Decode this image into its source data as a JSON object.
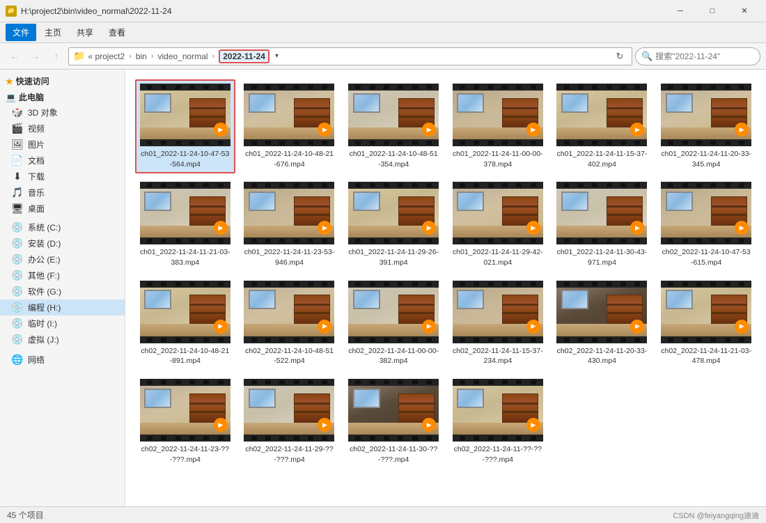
{
  "titlebar": {
    "path": "H:\\project2\\bin\\video_normal\\2022-11-24",
    "controls": {
      "minimize": "─",
      "maximize": "□",
      "close": "✕"
    }
  },
  "menubar": {
    "items": [
      "文件",
      "主页",
      "共享",
      "查看"
    ]
  },
  "addressbar": {
    "crumbs": [
      "project2",
      "bin",
      "video_normal",
      "2022-11-24"
    ],
    "search_placeholder": "搜索\"2022-11-24\""
  },
  "sidebar": {
    "quick_access": {
      "label": "快速访问",
      "icon": "★"
    },
    "this_pc": {
      "label": "此电脑",
      "icon": "💻",
      "children": [
        {
          "label": "3D 对象",
          "icon": "🎲"
        },
        {
          "label": "视频",
          "icon": "🎬"
        },
        {
          "label": "图片",
          "icon": "🖼"
        },
        {
          "label": "文档",
          "icon": "📄"
        },
        {
          "label": "下载",
          "icon": "⬇"
        },
        {
          "label": "音乐",
          "icon": "🎵"
        },
        {
          "label": "桌面",
          "icon": "🖥"
        }
      ]
    },
    "drives": [
      {
        "label": "系统 (C:)",
        "icon": "💿"
      },
      {
        "label": "安装 (D:)",
        "icon": "💿"
      },
      {
        "label": "办公 (E:)",
        "icon": "💿"
      },
      {
        "label": "其他 (F:)",
        "icon": "💿"
      },
      {
        "label": "软件 (G:)",
        "icon": "💿"
      },
      {
        "label": "编程 (H:)",
        "icon": "💿",
        "active": true
      },
      {
        "label": "临时 (I:)",
        "icon": "💿"
      },
      {
        "label": "虚拟 (J:)",
        "icon": "💿"
      }
    ],
    "network": {
      "label": "网络",
      "icon": "🌐"
    }
  },
  "files": [
    {
      "name": "ch01_2022-11-24-10-47-53-564.mp4",
      "selected": true,
      "variant": 1
    },
    {
      "name": "ch01_2022-11-24-10-48-21-676.mp4",
      "selected": false,
      "variant": 2
    },
    {
      "name": "ch01_2022-11-24-10-48-51-354.mp4",
      "selected": false,
      "variant": 3
    },
    {
      "name": "ch01_2022-11-24-11-00-00-378.mp4",
      "selected": false,
      "variant": 4
    },
    {
      "name": "ch01_2022-11-24-11-15-37-402.mp4",
      "selected": false,
      "variant": 1
    },
    {
      "name": "ch01_2022-11-24-11-20-33-345.mp4",
      "selected": false,
      "variant": 2
    },
    {
      "name": "ch01_2022-11-24-11-21-03-383.mp4",
      "selected": false,
      "variant": 3
    },
    {
      "name": "ch01_2022-11-24-11-23-53-946.mp4",
      "selected": false,
      "variant": 4
    },
    {
      "name": "ch01_2022-11-24-11-29-26-391.mp4",
      "selected": false,
      "variant": 1
    },
    {
      "name": "ch01_2022-11-24-11-29-42-021.mp4",
      "selected": false,
      "variant": 2
    },
    {
      "name": "ch01_2022-11-24-11-30-43-971.mp4",
      "selected": false,
      "variant": 3
    },
    {
      "name": "ch02_2022-11-24-10-47-53-615.mp4",
      "selected": false,
      "variant": 4
    },
    {
      "name": "ch02_2022-11-24-10-48-21-891.mp4",
      "selected": false,
      "variant": 1
    },
    {
      "name": "ch02_2022-11-24-10-48-51-522.mp4",
      "selected": false,
      "variant": 2
    },
    {
      "name": "ch02_2022-11-24-11-00-00-382.mp4",
      "selected": false,
      "variant": 3
    },
    {
      "name": "ch02_2022-11-24-11-15-37-234.mp4",
      "selected": false,
      "variant": 4
    },
    {
      "name": "ch02_2022-11-24-11-20-33-430.mp4",
      "selected": false,
      "variant": 5
    },
    {
      "name": "ch02_2022-11-24-11-21-03-478.mp4",
      "selected": false,
      "variant": 1
    },
    {
      "name": "ch02_2022-11-24-11-23-??-???.mp4",
      "selected": false,
      "variant": 2
    },
    {
      "name": "ch02_2022-11-24-11-29-??-???.mp4",
      "selected": false,
      "variant": 3
    },
    {
      "name": "ch02_2022-11-24-11-30-??-???.mp4",
      "selected": false,
      "variant": 5
    },
    {
      "name": "ch02_2022-11-24-11-??-??-???.mp4",
      "selected": false,
      "variant": 1
    }
  ],
  "statusbar": {
    "count": "45 个项目",
    "watermark": "CSDN @feiyangqing迪迪"
  }
}
